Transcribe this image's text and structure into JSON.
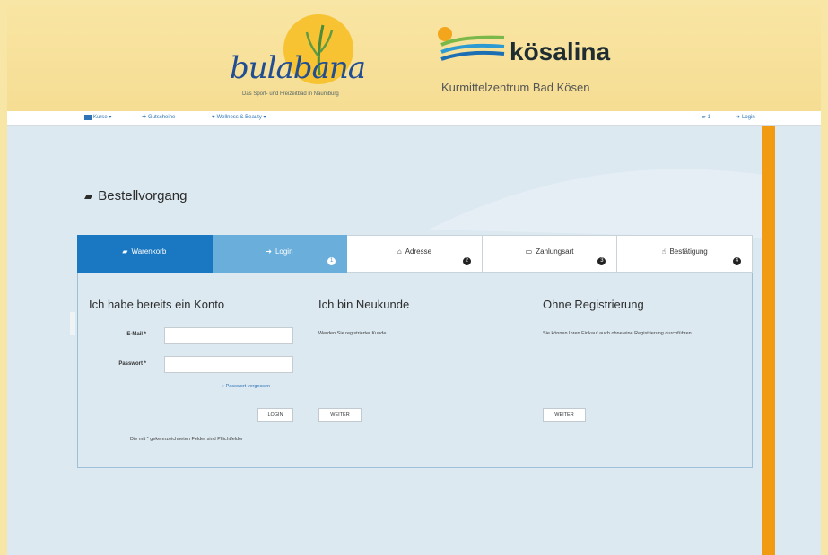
{
  "logos": {
    "bulabana": {
      "word": "bulabana",
      "subtitle": "Das Sport- und Freizeitbad in Naumburg"
    },
    "kosalina": {
      "word": "kösalina",
      "subtitle": "Kurmittelzentrum Bad Kösen"
    }
  },
  "nav": {
    "kurse": "Kurse ▾",
    "gutscheine": "Gutscheine",
    "wellness": "Wellness & Beauty ▾",
    "cart_count": "1",
    "login": "Login"
  },
  "page": {
    "title": "Bestellvorgang"
  },
  "steps": [
    {
      "label": "Warenkorb",
      "number": ""
    },
    {
      "label": "Login",
      "number": "1"
    },
    {
      "label": "Adresse",
      "number": "2"
    },
    {
      "label": "Zahlungsart",
      "number": "3"
    },
    {
      "label": "Bestätigung",
      "number": "4"
    }
  ],
  "account": {
    "heading": "Ich habe bereits ein Konto",
    "email_label": "E-Mail *",
    "email_value": "",
    "password_label": "Passwort *",
    "password_value": "",
    "forgot_link": "» Passwort vergessen",
    "login_button": "LOGIN",
    "required_note": "Die mit * gekennzeichneten Felder sind Pflichtfelder"
  },
  "new_customer": {
    "heading": "Ich bin Neukunde",
    "text": "Werden Sie registrierter Kunde.",
    "button": "WEITER"
  },
  "guest": {
    "heading": "Ohne Registrierung",
    "text": "Sie können Ihren Einkauf auch ohne eine Registrierung durchführen.",
    "button": "WEITER"
  },
  "colors": {
    "primary": "#1a78c2",
    "active_step": "#6aaedb",
    "accent_orange": "#f09b12",
    "background": "#dce9f1"
  }
}
